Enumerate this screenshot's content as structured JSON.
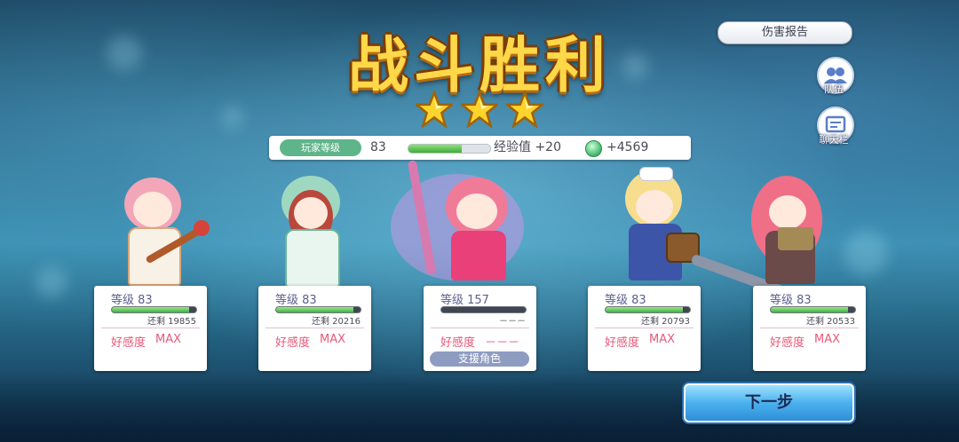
{
  "title": "战斗胜利",
  "stars": 3,
  "player": {
    "level_label": "玩家等级",
    "level_value": "83",
    "exp_fill_pct": 65,
    "exp_label": "经验值 +20",
    "coin_label": "+4569"
  },
  "top_right": {
    "damage_report": "伤害报告",
    "team": "队伍",
    "chat": "聊天栏"
  },
  "characters": [
    {
      "level": "等级 83",
      "remain": "还剩  19855",
      "exp_fill_pct": 92,
      "fav_label": "好感度",
      "fav_value": "MAX"
    },
    {
      "level": "等级 83",
      "remain": "还剩  20216",
      "exp_fill_pct": 92,
      "fav_label": "好感度",
      "fav_value": "MAX"
    },
    {
      "level": "等级 157",
      "remain": "－－－",
      "exp_fill_pct": 0,
      "fav_label": "好感度",
      "fav_value": "－－－",
      "support": "支援角色"
    },
    {
      "level": "等级 83",
      "remain": "还剩  20793",
      "exp_fill_pct": 92,
      "fav_label": "好感度",
      "fav_value": "MAX"
    },
    {
      "level": "等级 83",
      "remain": "还剩  20533",
      "exp_fill_pct": 92,
      "fav_label": "好感度",
      "fav_value": "MAX"
    }
  ],
  "next_button": "下一步",
  "colors": {
    "title": "#ffd84a",
    "accent": "#5fb58a",
    "favor": "#e8587a",
    "next": "#4bb1ee"
  }
}
